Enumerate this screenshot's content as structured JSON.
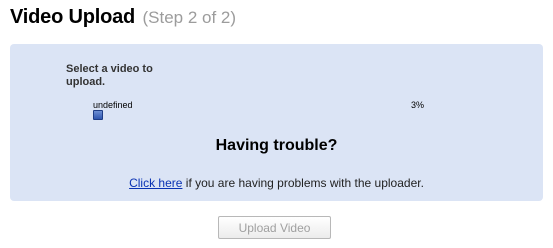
{
  "header": {
    "title": "Video Upload",
    "step": "(Step 2 of 2)"
  },
  "panel": {
    "select_label": "Select a video to upload.",
    "file": {
      "name": "undefined",
      "percent_text": "3%",
      "progress": 0.03
    },
    "trouble_heading": "Having trouble?",
    "help_link": "Click here",
    "help_text": " if you are having problems with the uploader."
  },
  "actions": {
    "upload_label": "Upload Video",
    "upload_disabled": true
  },
  "colors": {
    "panel_bg": "#dbe4f5",
    "link": "#0a32b4",
    "progress": "#2f56b0",
    "step_text": "#9c9c9c"
  }
}
